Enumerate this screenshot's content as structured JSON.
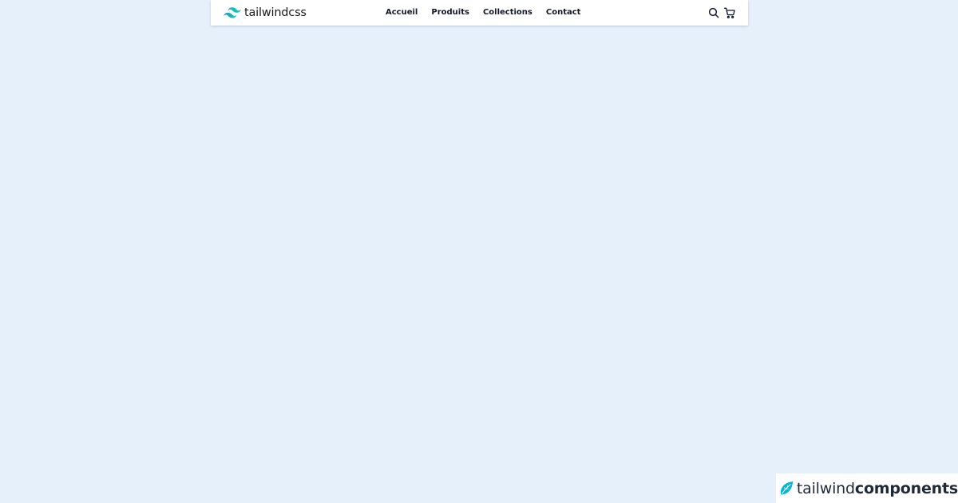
{
  "navbar": {
    "brand": {
      "label": "tailwindcss",
      "icon": "tailwind-logo-icon",
      "color": "#38bdf8"
    },
    "links": [
      {
        "label": "Accueil"
      },
      {
        "label": "Produits"
      },
      {
        "label": "Collections"
      },
      {
        "label": "Contact"
      }
    ],
    "actions": {
      "search_icon": "search-icon",
      "cart_icon": "cart-icon"
    }
  },
  "watermark": {
    "light_text": "tailwind",
    "bold_text": "components",
    "icon": "tailwind-leaf-icon",
    "accent": "#06b6d4"
  },
  "colors": {
    "background": "#e6f0fb",
    "navbar": "#ffffff",
    "text": "#111827"
  }
}
